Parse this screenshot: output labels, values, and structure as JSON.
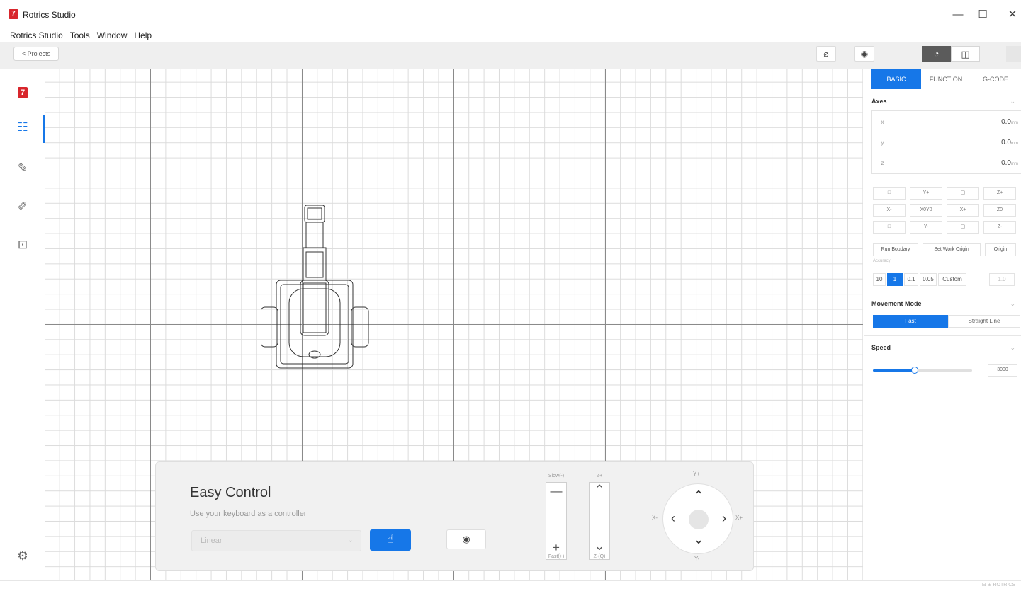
{
  "window": {
    "title": "Rotrics Studio",
    "controls": [
      "—",
      "☐",
      "✕"
    ]
  },
  "menu": [
    "Rotrics Studio",
    "Tools",
    "Window",
    "Help"
  ],
  "toolbar": {
    "projects_label": "< Projects",
    "pen_icon": "pen-icon",
    "record_icon": "record-icon"
  },
  "sidebar": {
    "items": [
      {
        "name": "logo",
        "icon": "rotrics-logo-icon"
      },
      {
        "name": "control",
        "icon": "sliders-icon",
        "active": true
      },
      {
        "name": "draw",
        "icon": "pen-icon"
      },
      {
        "name": "laser",
        "icon": "laser-icon"
      },
      {
        "name": "project",
        "icon": "book-icon"
      },
      {
        "name": "settings",
        "icon": "gear-icon"
      }
    ]
  },
  "easy_control": {
    "title": "Easy Control",
    "subtitle": "Use your keyboard as a controller",
    "select_value": "Linear",
    "slow_label": "Slow(-)",
    "fast_label": "Fast(+)",
    "z_up_label": "Z+",
    "z_down_label": "Z-(Q)",
    "y_plus": "Y+",
    "y_minus": "Y-",
    "x_minus": "X-",
    "x_plus": "X+"
  },
  "right_panel": {
    "tabs": [
      "BASIC",
      "FUNCTION",
      "G-CODE"
    ],
    "active_tab": "BASIC",
    "axes_title": "Axes",
    "axes": [
      {
        "name": "x",
        "value": "0.0",
        "unit": "mm"
      },
      {
        "name": "y",
        "value": "0.0",
        "unit": "mm"
      },
      {
        "name": "z",
        "value": "0.0",
        "unit": "mm"
      }
    ],
    "jog_buttons": [
      [
        "□",
        "Y+",
        "▢",
        "Z+"
      ],
      [
        "X-",
        "X0Y0",
        "X+",
        "Z0"
      ],
      [
        "□",
        "Y-",
        "▢",
        "Z-"
      ]
    ],
    "actions": [
      "Run Boudary",
      "Set Work Origin",
      "Origin"
    ],
    "accuracy_label": "Accuracy",
    "accuracy_options": [
      "10",
      "1",
      "0.1",
      "0.05",
      "Custom",
      "1.0"
    ],
    "accuracy_selected": "1",
    "movement_title": "Movement Mode",
    "movement_options": [
      "Fast",
      "Straight Line"
    ],
    "movement_selected": "Fast",
    "speed_title": "Speed",
    "speed_value": "3000",
    "speed_fraction": 0.42
  },
  "status_right": "⊟ ⊞ ROTRICS"
}
